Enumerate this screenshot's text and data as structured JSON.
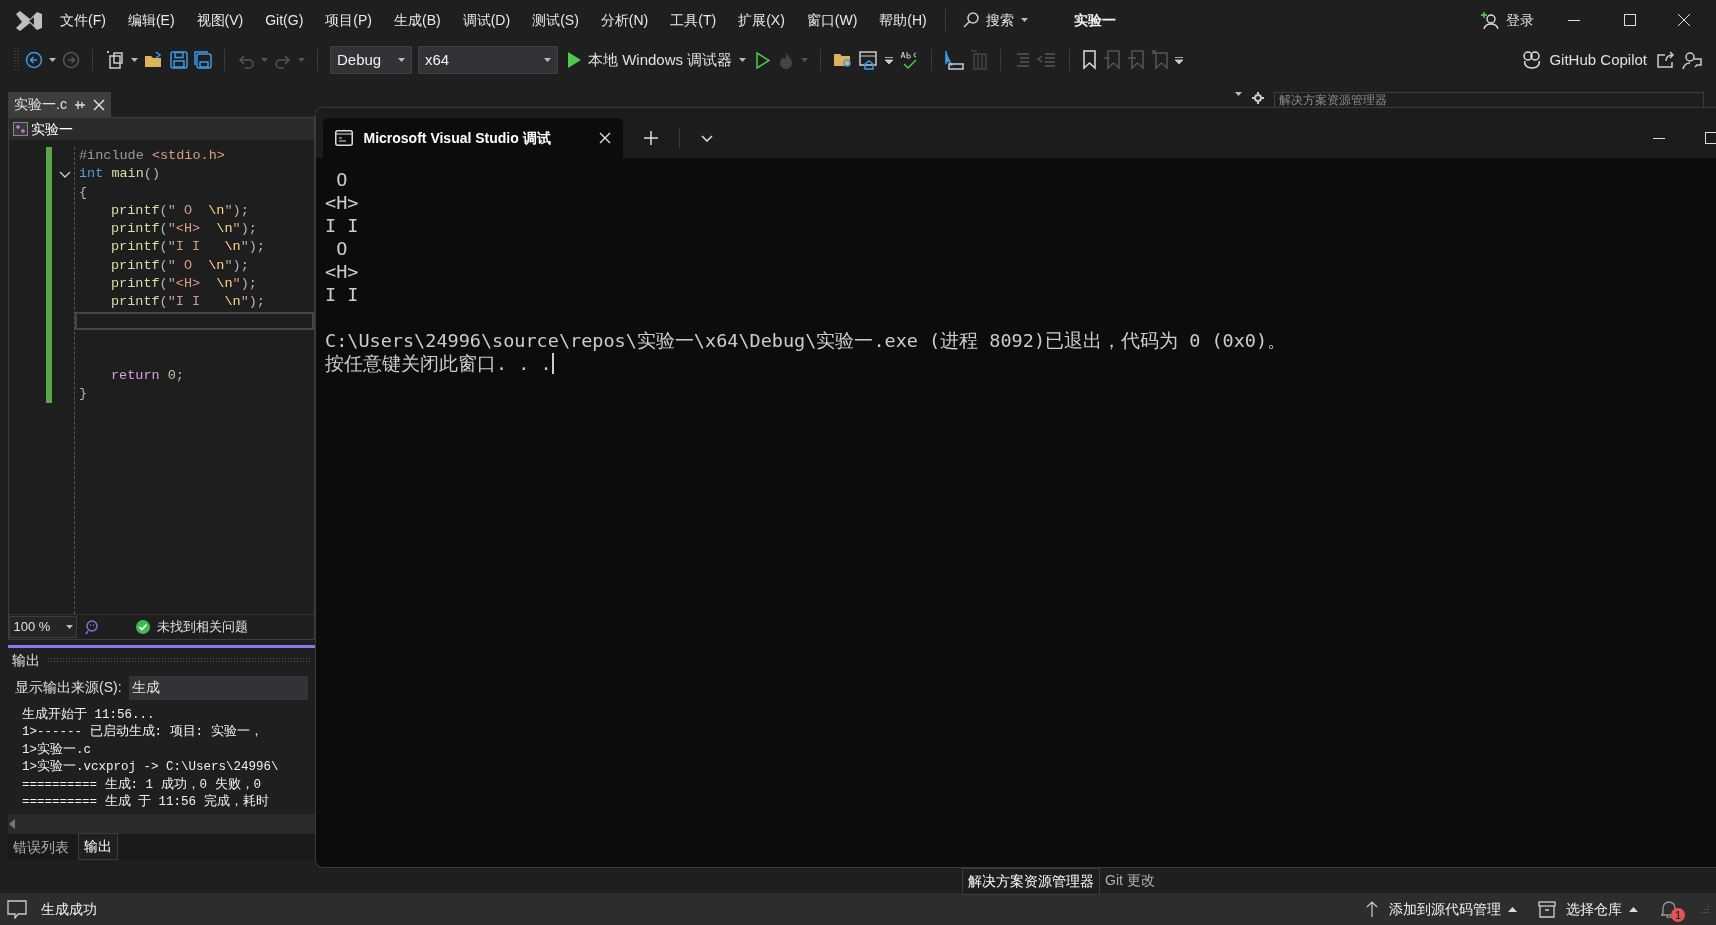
{
  "title_bar": {
    "menu": [
      "文件(F)",
      "编辑(E)",
      "视图(V)",
      "Git(G)",
      "项目(P)",
      "生成(B)",
      "调试(D)",
      "测试(S)",
      "分析(N)",
      "工具(T)",
      "扩展(X)",
      "窗口(W)",
      "帮助(H)"
    ],
    "search": "搜索",
    "solution": "实验一",
    "login": "登录"
  },
  "toolbar": {
    "configuration": "Debug",
    "platform": "x64",
    "debugger": "本地 Windows 调试器",
    "copilot": "GitHub Copilot"
  },
  "editor": {
    "tabs": [
      {
        "label": "实验一.c",
        "selected": true
      }
    ],
    "nav": "实验一",
    "zoom": "100 %",
    "issues": "未找到相关问题",
    "lines": [
      {
        "kind": "code",
        "tokens": [
          {
            "kind": "pre",
            "text": "#include "
          },
          {
            "kind": "str",
            "text": "<stdio.h>"
          }
        ]
      },
      {
        "kind": "fold",
        "tokens": [
          {
            "kind": "kw",
            "text": "int "
          },
          {
            "kind": "fn",
            "text": "main"
          },
          {
            "kind": "p",
            "text": "()"
          }
        ]
      },
      {
        "kind": "code",
        "tokens": [
          {
            "kind": "p",
            "text": "{"
          }
        ]
      },
      {
        "kind": "indented",
        "tokens": [
          {
            "kind": "fn",
            "text": "printf"
          },
          {
            "kind": "p",
            "text": "("
          },
          {
            "kind": "str",
            "text": "\" O  "
          },
          {
            "kind": "esc",
            "text": "\\n"
          },
          {
            "kind": "str",
            "text": "\""
          },
          {
            "kind": "p",
            "text": ");"
          }
        ]
      },
      {
        "kind": "indented",
        "tokens": [
          {
            "kind": "fn",
            "text": "printf"
          },
          {
            "kind": "p",
            "text": "("
          },
          {
            "kind": "str",
            "text": "\"<H>  "
          },
          {
            "kind": "esc",
            "text": "\\n"
          },
          {
            "kind": "str",
            "text": "\""
          },
          {
            "kind": "p",
            "text": ");"
          }
        ]
      },
      {
        "kind": "indented",
        "tokens": [
          {
            "kind": "fn",
            "text": "printf"
          },
          {
            "kind": "p",
            "text": "("
          },
          {
            "kind": "str",
            "text": "\"I I   "
          },
          {
            "kind": "esc",
            "text": "\\n"
          },
          {
            "kind": "str",
            "text": "\""
          },
          {
            "kind": "p",
            "text": ");"
          }
        ]
      },
      {
        "kind": "indented",
        "tokens": [
          {
            "kind": "fn",
            "text": "printf"
          },
          {
            "kind": "p",
            "text": "("
          },
          {
            "kind": "str",
            "text": "\" O  "
          },
          {
            "kind": "esc",
            "text": "\\n"
          },
          {
            "kind": "str",
            "text": "\""
          },
          {
            "kind": "p",
            "text": ");"
          }
        ]
      },
      {
        "kind": "indented",
        "tokens": [
          {
            "kind": "fn",
            "text": "printf"
          },
          {
            "kind": "p",
            "text": "("
          },
          {
            "kind": "str",
            "text": "\"<H>  "
          },
          {
            "kind": "esc",
            "text": "\\n"
          },
          {
            "kind": "str",
            "text": "\""
          },
          {
            "kind": "p",
            "text": ");"
          }
        ]
      },
      {
        "kind": "indented",
        "tokens": [
          {
            "kind": "fn",
            "text": "printf"
          },
          {
            "kind": "p",
            "text": "("
          },
          {
            "kind": "str",
            "text": "\"I I   "
          },
          {
            "kind": "esc",
            "text": "\\n"
          },
          {
            "kind": "str",
            "text": "\""
          },
          {
            "kind": "p",
            "text": ");"
          }
        ]
      },
      {
        "kind": "current"
      },
      {
        "kind": "blank"
      },
      {
        "kind": "blank"
      },
      {
        "kind": "indented",
        "tokens": [
          {
            "kind": "ret",
            "text": "return "
          },
          {
            "kind": "num",
            "text": "0"
          },
          {
            "kind": "p",
            "text": ";"
          }
        ]
      },
      {
        "kind": "code",
        "tokens": [
          {
            "kind": "p",
            "text": "}"
          }
        ]
      }
    ]
  },
  "output": {
    "title": "输出",
    "source_label": "显示输出来源(S):",
    "source": "生成",
    "lines": [
      "生成开始于 11:56...",
      "1>------ 已启动生成: 项目: 实验一，",
      "1>实验一.c",
      "1>实验一.vcxproj -> C:\\Users\\24996\\",
      "========== 生成: 1 成功，0 失败，0",
      "========== 生成 于 11:56 完成，耗时"
    ],
    "tabs": [
      {
        "label": "错误列表",
        "selected": false
      },
      {
        "label": "输出",
        "selected": true
      }
    ]
  },
  "solution_explorer": {
    "title": "解决方案资源管理器",
    "tabs": [
      {
        "label": "解决方案资源管理器",
        "selected": true
      },
      {
        "label": "Git 更改",
        "selected": false
      }
    ]
  },
  "console": {
    "tab": "Microsoft Visual Studio 调试",
    "lines": [
      {
        "kind": "program",
        "text": " O"
      },
      {
        "kind": "program",
        "text": "<H>"
      },
      {
        "kind": "program",
        "text": "I I"
      },
      {
        "kind": "program",
        "text": " O"
      },
      {
        "kind": "program",
        "text": "<H>"
      },
      {
        "kind": "program",
        "text": "I I"
      },
      {
        "kind": "system",
        "text": "C:\\Users\\24996\\source\\repos\\实验一\\x64\\Debug\\实验一.exe (进程 8092)已退出，代码为 0 (0x0)。"
      },
      {
        "kind": "system",
        "text": "按任意键关闭此窗口. . ."
      }
    ]
  },
  "status_bar": {
    "message": "生成成功",
    "source_control": "添加到源代码管理",
    "repository": "选择仓库",
    "notifications": "1"
  }
}
